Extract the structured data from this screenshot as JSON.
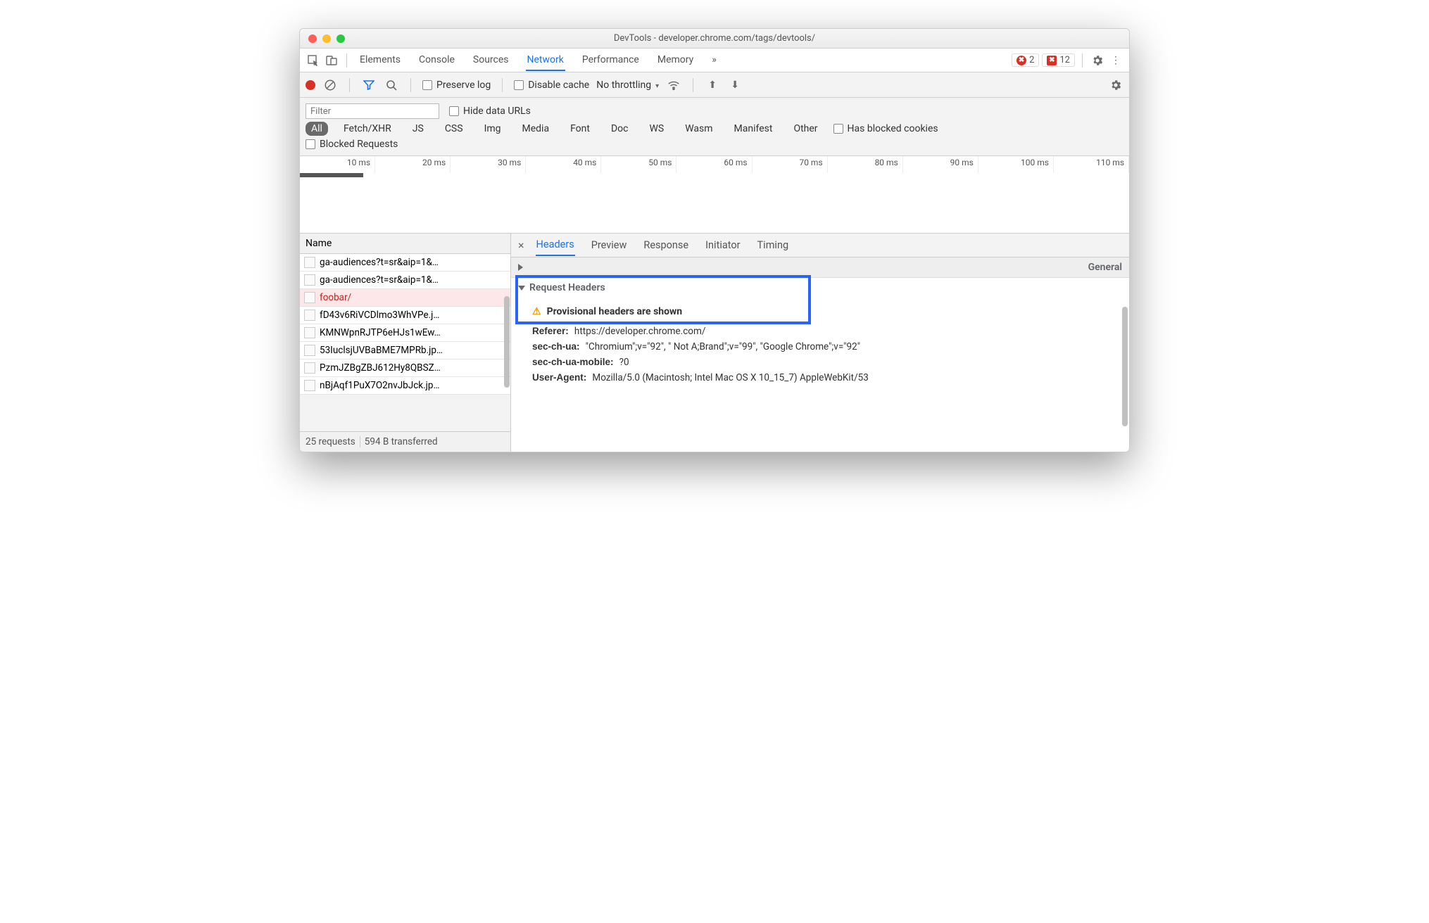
{
  "window": {
    "title": "DevTools - developer.chrome.com/tags/devtools/"
  },
  "mainTabs": [
    "Elements",
    "Console",
    "Sources",
    "Network",
    "Performance",
    "Memory"
  ],
  "activeMainTab": "Network",
  "errorBadge": "2",
  "issueBadge": "12",
  "toolbar": {
    "preserveLog": "Preserve log",
    "disableCache": "Disable cache",
    "throttling": "No throttling"
  },
  "filter": {
    "placeholder": "Filter",
    "hideDataUrls": "Hide data URLs",
    "types": [
      "All",
      "Fetch/XHR",
      "JS",
      "CSS",
      "Img",
      "Media",
      "Font",
      "Doc",
      "WS",
      "Wasm",
      "Manifest",
      "Other"
    ],
    "hasBlockedCookies": "Has blocked cookies",
    "blockedRequests": "Blocked Requests"
  },
  "waterfallTicks": [
    "10 ms",
    "20 ms",
    "30 ms",
    "40 ms",
    "50 ms",
    "60 ms",
    "70 ms",
    "80 ms",
    "90 ms",
    "100 ms",
    "110 ms"
  ],
  "requests": {
    "header": "Name",
    "rows": [
      {
        "name": "ga-audiences?t=sr&aip=1&…",
        "err": false
      },
      {
        "name": "ga-audiences?t=sr&aip=1&…",
        "err": false
      },
      {
        "name": "foobar/",
        "err": true
      },
      {
        "name": "fD43v6RiVCDlmo3WhVPe.j…",
        "err": false
      },
      {
        "name": "KMNWpnRJTP6eHJs1wEw…",
        "err": false
      },
      {
        "name": "53IuclsjUVBaBME7MPRb.jp…",
        "err": false
      },
      {
        "name": "PzmJZBgZBJ612Hy8QBSZ…",
        "err": false
      },
      {
        "name": "nBjAqf1PuX7O2nvJbJck.jp…",
        "err": false
      }
    ],
    "status": {
      "count": "25 requests",
      "transferred": "594 B transferred"
    }
  },
  "detailTabs": [
    "Headers",
    "Preview",
    "Response",
    "Initiator",
    "Timing"
  ],
  "activeDetailTab": "Headers",
  "sections": {
    "general": "General",
    "reqHeaders": "Request Headers",
    "provisional": "Provisional headers are shown",
    "headers": [
      {
        "k": "Referer:",
        "v": "https://developer.chrome.com/"
      },
      {
        "k": "sec-ch-ua:",
        "v": "\"Chromium\";v=\"92\", \" Not A;Brand\";v=\"99\", \"Google Chrome\";v=\"92\""
      },
      {
        "k": "sec-ch-ua-mobile:",
        "v": "?0"
      },
      {
        "k": "User-Agent:",
        "v": "Mozilla/5.0 (Macintosh; Intel Mac OS X 10_15_7) AppleWebKit/53"
      }
    ]
  }
}
